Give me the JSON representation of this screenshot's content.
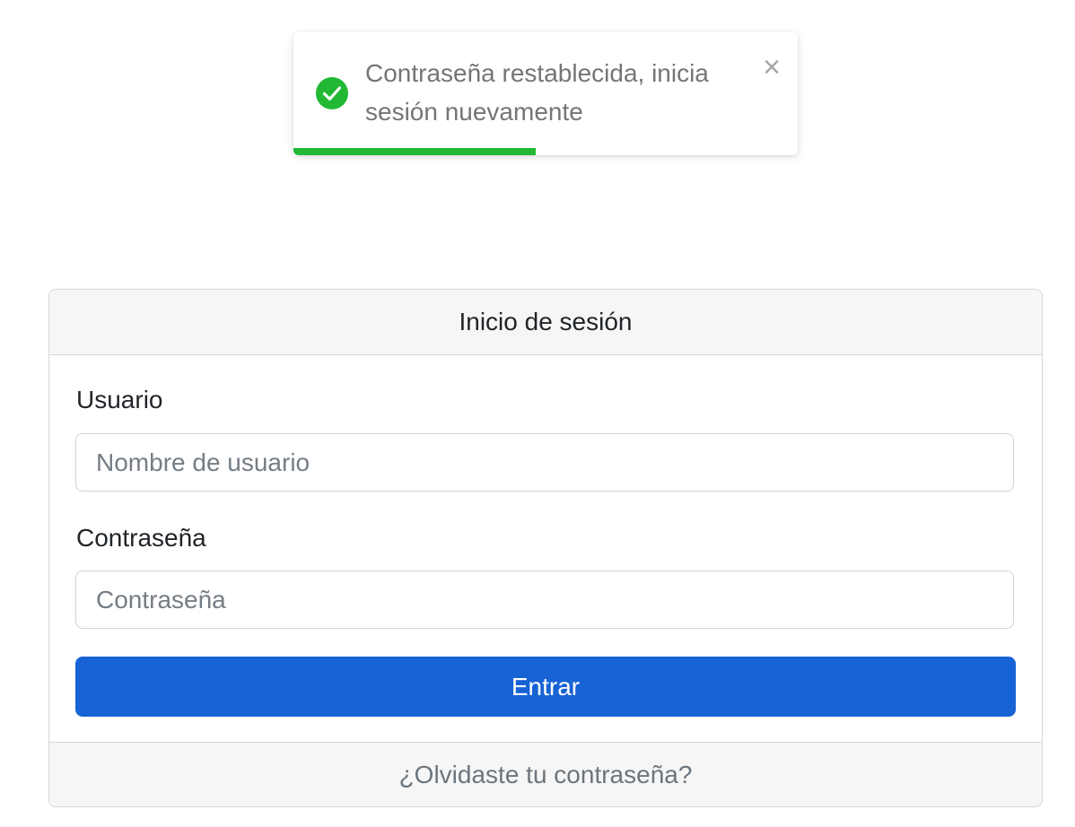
{
  "toast": {
    "message_line1": "Contraseña restablecida, inicia",
    "message_line2": "sesión nuevamente",
    "close_symbol": "×",
    "icon": "check-circle-icon",
    "icon_color": "#21b934",
    "progress_remaining": 0.48,
    "progress_color": "#21b934"
  },
  "login": {
    "title": "Inicio de sesión",
    "username_label": "Usuario",
    "username_placeholder": "Nombre de usuario",
    "username_value": "",
    "password_label": "Contraseña",
    "password_placeholder": "Contraseña",
    "password_value": "",
    "submit_label": "Entrar",
    "submit_color": "#1763d5",
    "forgot_link": "¿Olvidaste tu contraseña?"
  }
}
